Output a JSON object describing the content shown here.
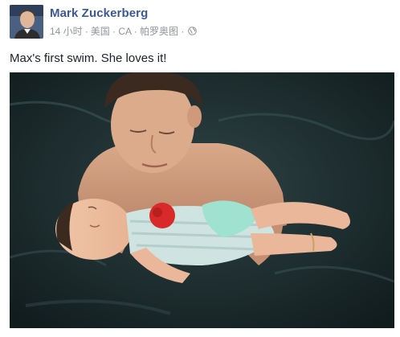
{
  "post": {
    "author_name": "Mark Zuckerberg",
    "timestamp": "14 小时",
    "location": "美国 · CA · 帕罗奥图 ·",
    "caption": "Max's first swim. She loves it!",
    "photo_icon": "swimming-photo",
    "privacy_icon": "globe-icon"
  },
  "colors": {
    "author": "#3b5998",
    "meta": "#90949c",
    "text": "#1d2129"
  }
}
